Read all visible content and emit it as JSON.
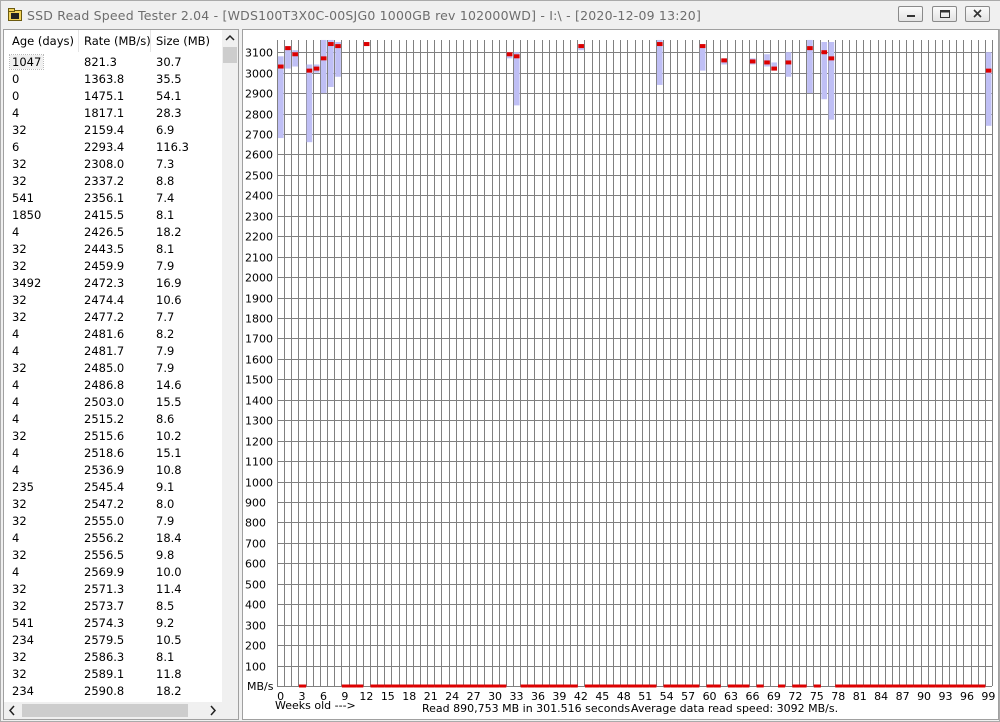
{
  "window": {
    "title": "SSD Read Speed Tester 2.04 - [WDS100T3X0C-00SJG0 1000GB rev 102000WD] - I:\\ - [2020-12-09 13:20]",
    "icons": {
      "app": "folder-disk-icon",
      "minimize": "minimize-icon",
      "maximize": "maximize-icon",
      "close": "close-icon"
    }
  },
  "list": {
    "columns": [
      "Age (days)",
      "Rate (MB/s)",
      "Size (MB)"
    ],
    "rows": [
      [
        "1047",
        "821.3",
        "30.7"
      ],
      [
        "0",
        "1363.8",
        "35.5"
      ],
      [
        "0",
        "1475.1",
        "54.1"
      ],
      [
        "4",
        "1817.1",
        "28.3"
      ],
      [
        "32",
        "2159.4",
        "6.9"
      ],
      [
        "6",
        "2293.4",
        "116.3"
      ],
      [
        "32",
        "2308.0",
        "7.3"
      ],
      [
        "32",
        "2337.2",
        "8.8"
      ],
      [
        "541",
        "2356.1",
        "7.4"
      ],
      [
        "1850",
        "2415.5",
        "8.1"
      ],
      [
        "4",
        "2426.5",
        "18.2"
      ],
      [
        "32",
        "2443.5",
        "8.1"
      ],
      [
        "32",
        "2459.9",
        "7.9"
      ],
      [
        "3492",
        "2472.3",
        "16.9"
      ],
      [
        "32",
        "2474.4",
        "10.6"
      ],
      [
        "32",
        "2477.2",
        "7.7"
      ],
      [
        "4",
        "2481.6",
        "8.2"
      ],
      [
        "4",
        "2481.7",
        "7.9"
      ],
      [
        "32",
        "2485.0",
        "7.9"
      ],
      [
        "4",
        "2486.8",
        "14.6"
      ],
      [
        "4",
        "2503.0",
        "15.5"
      ],
      [
        "4",
        "2515.2",
        "8.6"
      ],
      [
        "32",
        "2515.6",
        "10.2"
      ],
      [
        "4",
        "2518.6",
        "15.1"
      ],
      [
        "4",
        "2536.9",
        "10.8"
      ],
      [
        "235",
        "2545.4",
        "9.1"
      ],
      [
        "32",
        "2547.2",
        "8.0"
      ],
      [
        "32",
        "2555.0",
        "7.9"
      ],
      [
        "4",
        "2556.2",
        "18.4"
      ],
      [
        "32",
        "2556.5",
        "9.8"
      ],
      [
        "4",
        "2569.9",
        "10.0"
      ],
      [
        "32",
        "2571.3",
        "11.4"
      ],
      [
        "32",
        "2573.7",
        "8.5"
      ],
      [
        "541",
        "2574.3",
        "9.2"
      ],
      [
        "234",
        "2579.5",
        "10.5"
      ],
      [
        "32",
        "2586.3",
        "8.1"
      ],
      [
        "32",
        "2589.1",
        "11.8"
      ],
      [
        "234",
        "2590.8",
        "18.2"
      ]
    ]
  },
  "chart_data": {
    "type": "range-bar",
    "ylabel": "MB/s",
    "ylim": [
      0,
      3150
    ],
    "yticks": [
      100,
      200,
      300,
      400,
      500,
      600,
      700,
      800,
      900,
      1000,
      1100,
      1200,
      1300,
      1400,
      1500,
      1600,
      1700,
      1800,
      1900,
      2000,
      2100,
      2200,
      2300,
      2400,
      2500,
      2600,
      2700,
      2800,
      2900,
      3000,
      3100
    ],
    "xlabel": "Weeks old --->",
    "xticks": [
      0,
      3,
      6,
      9,
      12,
      15,
      18,
      21,
      24,
      27,
      30,
      33,
      36,
      39,
      42,
      45,
      48,
      51,
      54,
      57,
      60,
      63,
      66,
      69,
      72,
      75,
      78,
      81,
      84,
      87,
      90,
      93,
      96,
      99
    ],
    "xlim": [
      0,
      99
    ],
    "series": [
      {
        "week": 0,
        "min": 2680,
        "max": 3080,
        "avg": 3030
      },
      {
        "week": 1,
        "min": 3020,
        "max": 3130,
        "avg": 3120
      },
      {
        "week": 2,
        "min": 3030,
        "max": 3110,
        "avg": 3090
      },
      {
        "week": 4,
        "min": 2660,
        "max": 3040,
        "avg": 3010
      },
      {
        "week": 5,
        "min": 3000,
        "max": 3040,
        "avg": 3020
      },
      {
        "week": 6,
        "min": 2900,
        "max": 3160,
        "avg": 3070
      },
      {
        "week": 7,
        "min": 2930,
        "max": 3160,
        "avg": 3140
      },
      {
        "week": 8,
        "min": 2980,
        "max": 3150,
        "avg": 3130
      },
      {
        "week": 12,
        "min": 3130,
        "max": 3150,
        "avg": 3140
      },
      {
        "week": 32,
        "min": 3070,
        "max": 3100,
        "avg": 3090
      },
      {
        "week": 33,
        "min": 2840,
        "max": 3100,
        "avg": 3080
      },
      {
        "week": 42,
        "min": 3110,
        "max": 3140,
        "avg": 3130
      },
      {
        "week": 53,
        "min": 2940,
        "max": 3160,
        "avg": 3140
      },
      {
        "week": 59,
        "min": 3010,
        "max": 3140,
        "avg": 3130
      },
      {
        "week": 62,
        "min": 3040,
        "max": 3070,
        "avg": 3060
      },
      {
        "week": 66,
        "min": 3040,
        "max": 3070,
        "avg": 3055
      },
      {
        "week": 68,
        "min": 3030,
        "max": 3090,
        "avg": 3050
      },
      {
        "week": 69,
        "min": 3010,
        "max": 3050,
        "avg": 3020
      },
      {
        "week": 71,
        "min": 2980,
        "max": 3100,
        "avg": 3050
      },
      {
        "week": 74,
        "min": 2900,
        "max": 3160,
        "avg": 3120
      },
      {
        "week": 76,
        "min": 2870,
        "max": 3150,
        "avg": 3100
      },
      {
        "week": 77,
        "min": 2770,
        "max": 3150,
        "avg": 3070
      },
      {
        "week": 99,
        "min": 2740,
        "max": 3100,
        "avg": 3010
      }
    ],
    "empty_weeks": [
      3,
      9,
      10,
      11,
      13,
      14,
      15,
      16,
      17,
      18,
      19,
      20,
      21,
      22,
      23,
      24,
      25,
      26,
      27,
      28,
      29,
      30,
      31,
      34,
      35,
      36,
      37,
      38,
      39,
      40,
      41,
      43,
      44,
      45,
      46,
      47,
      48,
      49,
      50,
      51,
      52,
      54,
      55,
      56,
      57,
      58,
      60,
      61,
      63,
      64,
      65,
      67,
      70,
      72,
      73,
      75,
      78,
      79,
      80,
      81,
      82,
      83,
      84,
      85,
      86,
      87,
      88,
      89,
      90,
      91,
      92,
      93,
      94,
      95,
      96,
      97,
      98
    ],
    "colors": {
      "range": "#bfbff5",
      "avg": "#dd0000",
      "grid": "#808080"
    }
  },
  "status": {
    "read": "Read 890,753 MB in 301.516 seconds.",
    "average": "Average data read speed: 3092 MB/s."
  }
}
